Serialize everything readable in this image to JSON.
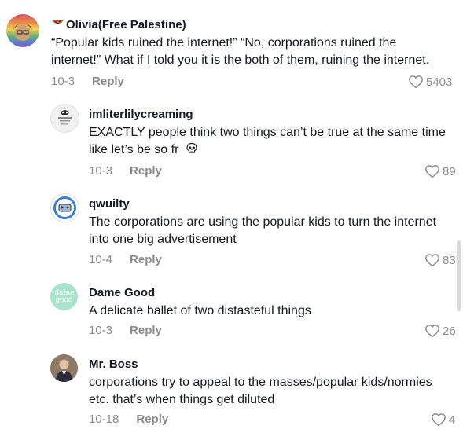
{
  "comments": [
    {
      "username": "Olivia(Free Palestine)",
      "badge_icon": "watermelon-icon",
      "line1": "“Popular kids ruined the internet!” “No, corporations ruined the",
      "line2": "internet!” What if I told you it is the both of them, ruining the internet.",
      "date": "10-3",
      "reply": "Reply",
      "likes": "5403"
    },
    {
      "username": "imliterlilycreaming",
      "line1": "EXACTLY people think two things can’t be true at the same time",
      "line2": "like let’s be so fr",
      "emoji_icon": "skull-icon",
      "date": "10-3",
      "reply": "Reply",
      "likes": "89"
    },
    {
      "username": "qwuilty",
      "line1": "The corporations are using the popular kids to turn the internet",
      "line2": "into one big advertisement",
      "date": "10-4",
      "reply": "Reply",
      "likes": "83"
    },
    {
      "username": "Dame Good",
      "avatar_text": "dame good",
      "line1": "A delicate ballet of two distasteful things",
      "date": "10-3",
      "reply": "Reply",
      "likes": "26"
    },
    {
      "username": "Mr. Boss",
      "line1": "corporations try to appeal to the masses/popular kids/normies",
      "line2": "etc. that’s when things get diluted",
      "date": "10-18",
      "reply": "Reply",
      "likes": "4"
    }
  ],
  "colors": {
    "text": "#161823",
    "meta": "#8a8b91",
    "dame_avatar_bg": "#a9e3cd"
  }
}
